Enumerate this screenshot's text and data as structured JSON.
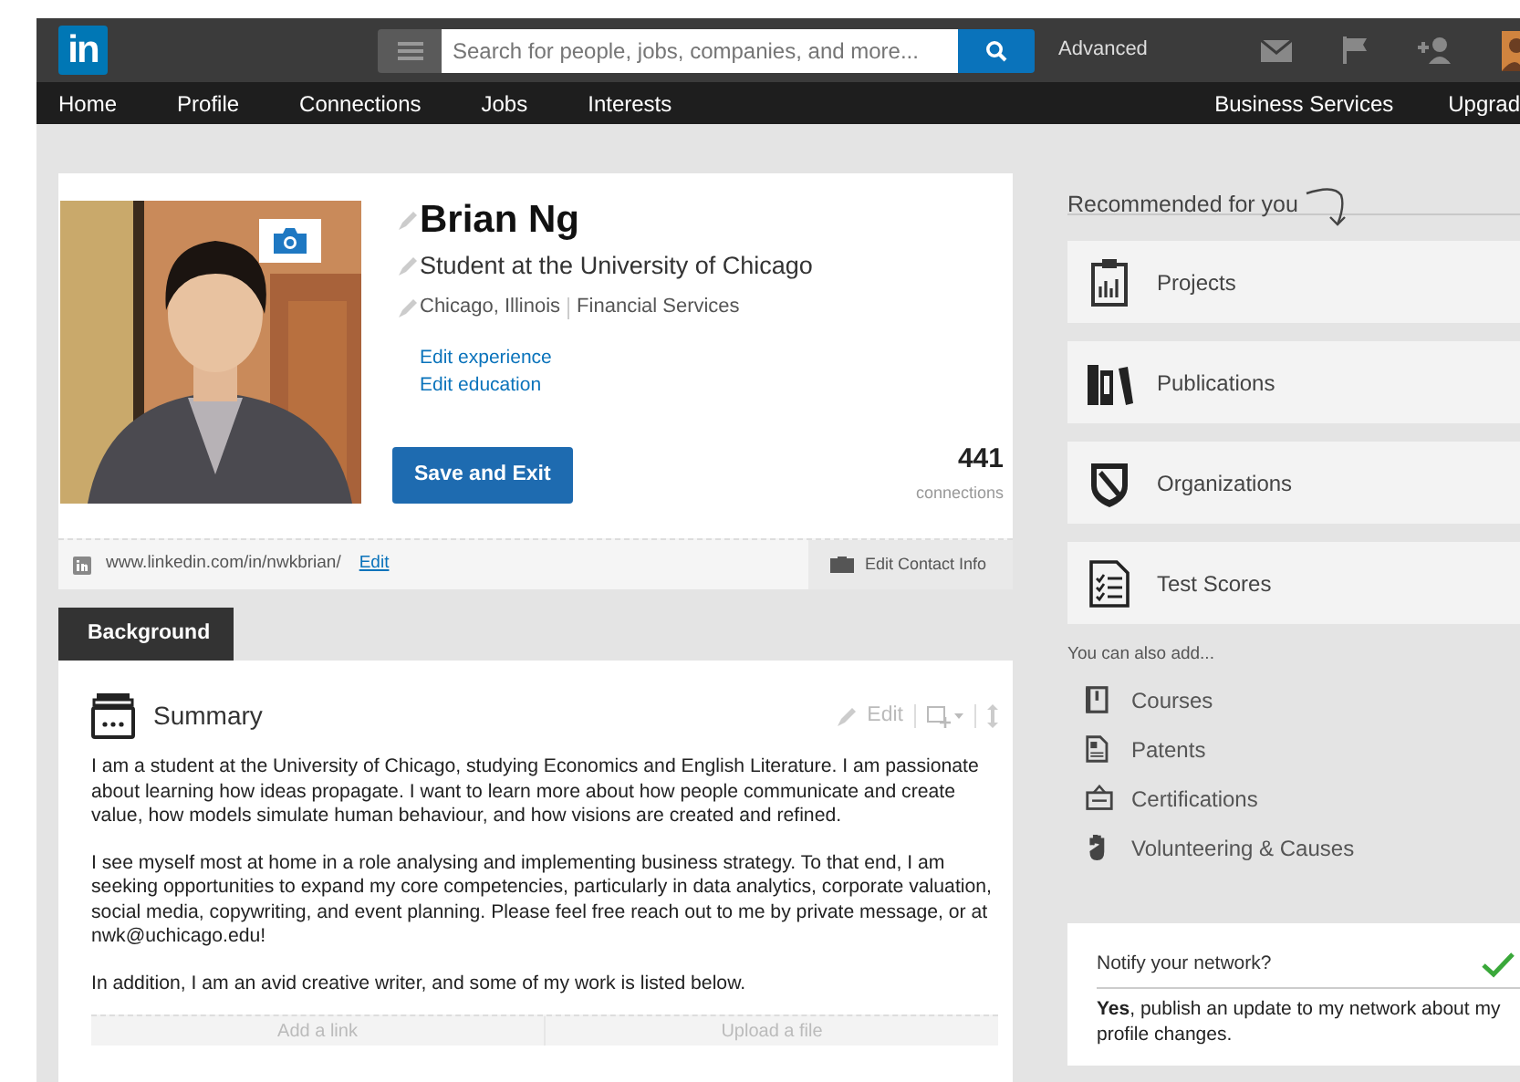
{
  "header": {
    "logo": "in",
    "search": {
      "placeholder": "Search for people, jobs, companies, and more..."
    },
    "advanced": "Advanced"
  },
  "nav": {
    "left": [
      "Home",
      "Profile",
      "Connections",
      "Jobs",
      "Interests"
    ],
    "right": [
      "Business Services",
      "Upgrad"
    ]
  },
  "profile": {
    "name": "Brian Ng",
    "headline": "Student at the University of Chicago",
    "location": "Chicago, Illinois",
    "industry": "Financial Services",
    "links": [
      "Edit experience",
      "Edit education"
    ],
    "save_button": "Save and Exit",
    "connections_count": "441",
    "connections_label": "connections",
    "url": "www.linkedin.com/in/nwkbrian/",
    "url_edit": "Edit",
    "contact": "Edit Contact Info"
  },
  "section_tab": "Background",
  "summary": {
    "title": "Summary",
    "edit": "Edit",
    "paragraphs": [
      "I am a student at the University of Chicago, studying Economics and English Literature. I am passionate about learning how ideas propagate. I want to learn more about how people communicate and create value, how models simulate human behaviour, and how visions are created and refined.",
      "I see myself most at home in a role analysing and implementing business strategy. To that end, I am seeking opportunities to expand my core competencies, particularly in data analytics, corporate valuation, social media, copywriting, and event planning. Please feel free reach out to me by private message, or at nwk@uchicago.edu!",
      "In addition, I am an avid creative writer, and some of my work is listed below."
    ],
    "actions": [
      "Add a link",
      "Upload a file"
    ]
  },
  "recommended": {
    "title": "Recommended for you",
    "items": [
      {
        "label": "Projects",
        "kind": "clipboard"
      },
      {
        "label": "Publications",
        "kind": "books"
      },
      {
        "label": "Organizations",
        "kind": "shield"
      },
      {
        "label": "Test Scores",
        "kind": "checklist"
      }
    ]
  },
  "also_add": {
    "title": "You can also add...",
    "items": [
      {
        "label": "Courses",
        "kind": "notebook"
      },
      {
        "label": "Patents",
        "kind": "document"
      },
      {
        "label": "Certifications",
        "kind": "certificate"
      },
      {
        "label": "Volunteering & Causes",
        "kind": "hand"
      }
    ]
  },
  "notify": {
    "title": "Notify your network?",
    "on": true,
    "text": "**Yes**, publish an update to my network about my profile changes."
  }
}
